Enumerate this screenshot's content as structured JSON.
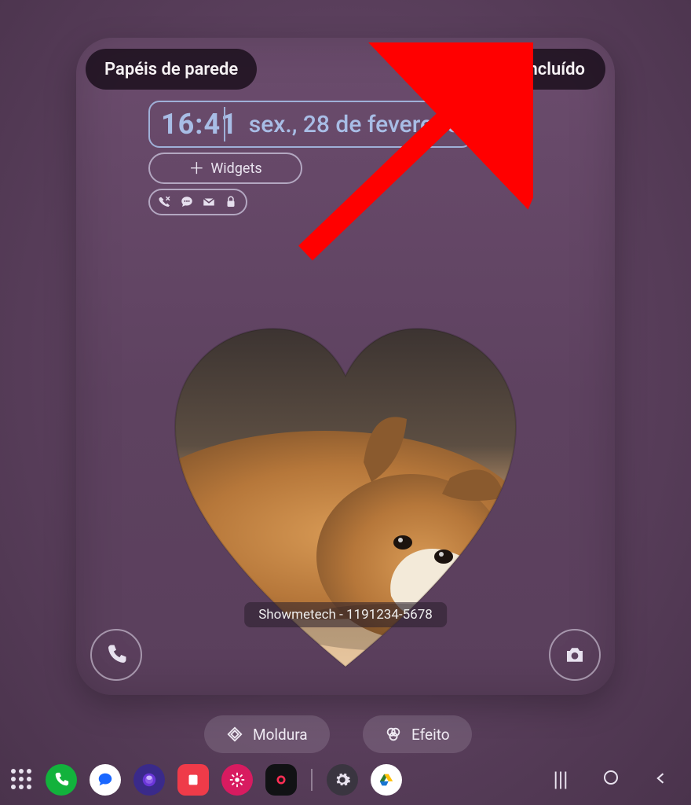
{
  "header": {
    "wallpapers_label": "Papéis de parede",
    "done_label": "Concluído"
  },
  "clock": {
    "time": "16:41",
    "date": "sex., 28 de fevereiro"
  },
  "widgets_button_label": "Widgets",
  "notification_icons": [
    "missed-call-icon",
    "chat-icon",
    "mail-icon",
    "lock-icon"
  ],
  "contact_caption": "Showmetech - 1191234-5678",
  "shortcuts": {
    "left": "phone-icon",
    "right": "camera-icon"
  },
  "options": {
    "frame_label": "Moldura",
    "effect_label": "Efeito"
  },
  "dock": {
    "apps": [
      {
        "name": "phone-app",
        "bg": "#12b23c"
      },
      {
        "name": "messages-app",
        "bg": "#1a67ff"
      },
      {
        "name": "browser-app",
        "bg": "#6a36d9"
      },
      {
        "name": "notes-app",
        "bg": "#ef3b49"
      },
      {
        "name": "gallery-app",
        "bg": "#d81b60"
      },
      {
        "name": "camera-app",
        "bg": "#111214"
      }
    ],
    "nav": [
      "recent",
      "home",
      "back"
    ]
  },
  "annotation": {
    "arrow_color": "#ff0000"
  }
}
